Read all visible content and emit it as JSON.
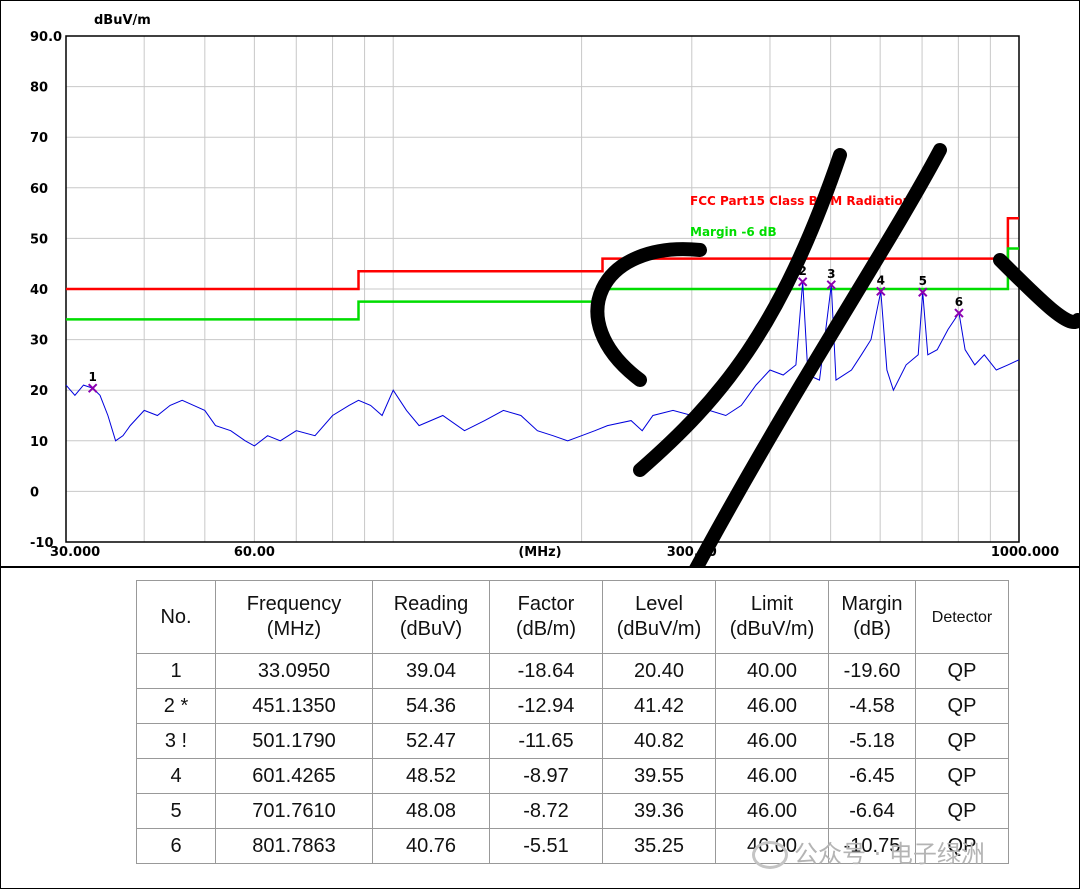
{
  "chart_data": {
    "type": "line",
    "title": "",
    "ylabel": "dBuV/m",
    "xlabel": "(MHz)",
    "x_scale": "log",
    "xlim": [
      30,
      1000
    ],
    "ylim": [
      -10,
      90
    ],
    "grid": true,
    "y_ticks": [
      "90.0",
      "80",
      "70",
      "60",
      "50",
      "40",
      "30",
      "20",
      "10",
      "0",
      "-10"
    ],
    "x_tick_labels": [
      {
        "x": 30,
        "label": "30.000"
      },
      {
        "x": 60,
        "label": "60.00"
      },
      {
        "x": 300,
        "label": "300.00"
      },
      {
        "x": 1000,
        "label": "1000.000"
      }
    ],
    "x_gridlines": [
      40,
      50,
      60,
      70,
      80,
      90,
      100,
      200,
      300,
      400,
      500,
      600,
      700,
      800,
      900
    ],
    "legend": [
      {
        "name": "FCC Part15 Class B 3M Radiation",
        "color": "#ff0000"
      },
      {
        "name": "Margin -6 dB",
        "color": "#00dd00"
      }
    ],
    "series": [
      {
        "name": "FCC Part15 Class B 3M Radiation",
        "color": "#ff0000",
        "points": [
          [
            30,
            40
          ],
          [
            88,
            40
          ],
          [
            88,
            43.5
          ],
          [
            216,
            43.5
          ],
          [
            216,
            46
          ],
          [
            960,
            46
          ],
          [
            960,
            54
          ],
          [
            1000,
            54
          ]
        ]
      },
      {
        "name": "Margin -6 dB",
        "color": "#00dd00",
        "points": [
          [
            30,
            34
          ],
          [
            88,
            34
          ],
          [
            88,
            37.5
          ],
          [
            216,
            37.5
          ],
          [
            216,
            40
          ],
          [
            960,
            40
          ],
          [
            960,
            48
          ],
          [
            1000,
            48
          ]
        ]
      },
      {
        "name": "",
        "color": "#0000dd",
        "points": [
          [
            30,
            21
          ],
          [
            31,
            19
          ],
          [
            32,
            21
          ],
          [
            33.1,
            20.4
          ],
          [
            34,
            19
          ],
          [
            35,
            15
          ],
          [
            36,
            10
          ],
          [
            37,
            11
          ],
          [
            38,
            13
          ],
          [
            40,
            16
          ],
          [
            42,
            15
          ],
          [
            44,
            17
          ],
          [
            46,
            18
          ],
          [
            48,
            17
          ],
          [
            50,
            16
          ],
          [
            52,
            13
          ],
          [
            55,
            12
          ],
          [
            58,
            10
          ],
          [
            60,
            9
          ],
          [
            63,
            11
          ],
          [
            66,
            10
          ],
          [
            70,
            12
          ],
          [
            75,
            11
          ],
          [
            80,
            15
          ],
          [
            85,
            17
          ],
          [
            88,
            18
          ],
          [
            92,
            17
          ],
          [
            96,
            15
          ],
          [
            100,
            20
          ],
          [
            105,
            16
          ],
          [
            110,
            13
          ],
          [
            120,
            15
          ],
          [
            130,
            12
          ],
          [
            140,
            14
          ],
          [
            150,
            16
          ],
          [
            160,
            15
          ],
          [
            170,
            12
          ],
          [
            180,
            11
          ],
          [
            190,
            10
          ],
          [
            200,
            11
          ],
          [
            210,
            12
          ],
          [
            220,
            13
          ],
          [
            240,
            14
          ],
          [
            250,
            12
          ],
          [
            260,
            15
          ],
          [
            280,
            16
          ],
          [
            300,
            15
          ],
          [
            320,
            16
          ],
          [
            340,
            15
          ],
          [
            360,
            17
          ],
          [
            380,
            21
          ],
          [
            400,
            24
          ],
          [
            420,
            23
          ],
          [
            440,
            25
          ],
          [
            451.135,
            41.42
          ],
          [
            460,
            23
          ],
          [
            480,
            22
          ],
          [
            501.179,
            40.82
          ],
          [
            510,
            22
          ],
          [
            540,
            24
          ],
          [
            560,
            27
          ],
          [
            580,
            30
          ],
          [
            601.4265,
            39.55
          ],
          [
            615,
            24
          ],
          [
            630,
            20
          ],
          [
            660,
            25
          ],
          [
            690,
            27
          ],
          [
            701.761,
            39.36
          ],
          [
            715,
            27
          ],
          [
            740,
            28
          ],
          [
            770,
            32
          ],
          [
            801.7863,
            35.25
          ],
          [
            820,
            28
          ],
          [
            850,
            25
          ],
          [
            880,
            27
          ],
          [
            920,
            24
          ],
          [
            960,
            25
          ],
          [
            1000,
            26
          ]
        ]
      }
    ],
    "markers": [
      {
        "label": "1",
        "x": 33.095,
        "y": 20.4
      },
      {
        "label": "2",
        "x": 451.135,
        "y": 41.42
      },
      {
        "label": "3",
        "x": 501.179,
        "y": 40.82
      },
      {
        "label": "4",
        "x": 601.4265,
        "y": 39.55
      },
      {
        "label": "5",
        "x": 701.761,
        "y": 39.36
      },
      {
        "label": "6",
        "x": 801.7863,
        "y": 35.25
      }
    ]
  },
  "table": {
    "headers": [
      "No.",
      "Frequency (MHz)",
      "Reading (dBuV)",
      "Factor (dB/m)",
      "Level (dBuV/m)",
      "Limit (dBuV/m)",
      "Margin (dB)",
      "Detector"
    ],
    "header_lines": [
      [
        "No."
      ],
      [
        "Frequency",
        "(MHz)"
      ],
      [
        "Reading",
        "(dBuV)"
      ],
      [
        "Factor",
        "(dB/m)"
      ],
      [
        "Level",
        "(dBuV/m)"
      ],
      [
        "Limit",
        "(dBuV/m)"
      ],
      [
        "Margin",
        "(dB)"
      ],
      [
        "Detector"
      ]
    ],
    "rows": [
      [
        "1",
        "33.0950",
        "39.04",
        "-18.64",
        "20.40",
        "40.00",
        "-19.60",
        "QP"
      ],
      [
        "2 *",
        "451.1350",
        "54.36",
        "-12.94",
        "41.42",
        "46.00",
        "-4.58",
        "QP"
      ],
      [
        "3 !",
        "501.1790",
        "52.47",
        "-11.65",
        "40.82",
        "46.00",
        "-5.18",
        "QP"
      ],
      [
        "4",
        "601.4265",
        "48.52",
        "-8.97",
        "39.55",
        "46.00",
        "-6.45",
        "QP"
      ],
      [
        "5",
        "701.7610",
        "48.08",
        "-8.72",
        "39.36",
        "46.00",
        "-6.64",
        "QP"
      ],
      [
        "6",
        "801.7863",
        "40.76",
        "-5.51",
        "35.25",
        "46.00",
        "-10.75",
        "QP"
      ]
    ]
  },
  "watermark": {
    "text": "公众号 · 电子绿洲",
    "icon": "wechat-icon"
  }
}
